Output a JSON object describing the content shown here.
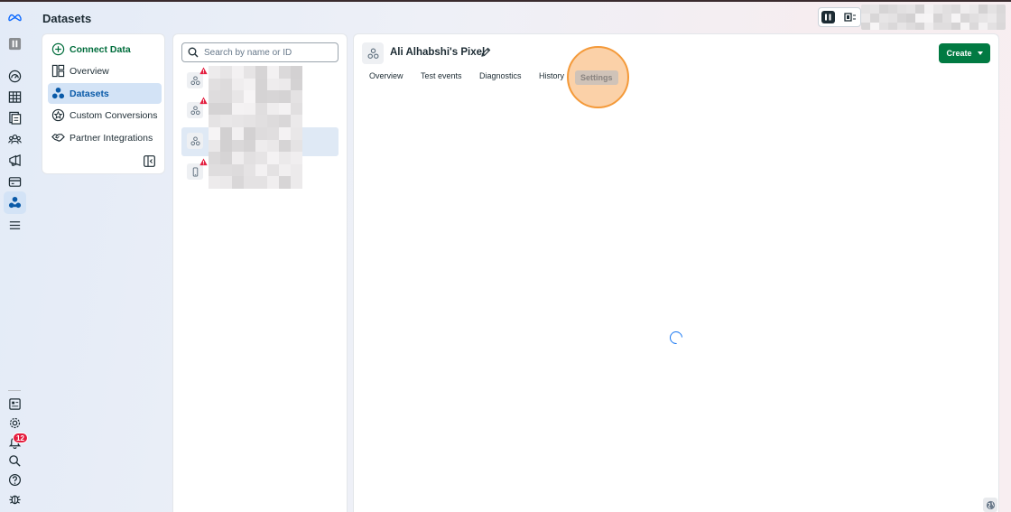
{
  "header": {
    "title": "Datasets"
  },
  "badges": {
    "notifications": "12"
  },
  "nav": {
    "connect": "Connect Data",
    "items": [
      "Overview",
      "Datasets",
      "Custom Conversions",
      "Partner Integrations"
    ]
  },
  "search": {
    "placeholder": "Search by name or ID"
  },
  "detail": {
    "title": "Ali Alhabshi's Pixel",
    "tabs": [
      "Overview",
      "Test events",
      "Diagnostics",
      "History",
      "Settings"
    ],
    "active_tab": "Settings",
    "create_label": "Create",
    "loading": true
  },
  "colors": {
    "accent_green": "#017a42",
    "selection_blue": "#d3e3f6",
    "highlight_orange": "#f49a3a",
    "warning_red": "#e41e3f"
  },
  "icons": [
    "meta-logo",
    "account-icon",
    "gauge-icon",
    "table-icon",
    "pages-icon",
    "audience-icon",
    "megaphone-icon",
    "billing-icon",
    "events-manager-icon",
    "menu-icon",
    "report-icon",
    "gear-icon",
    "bell-icon",
    "search-icon",
    "help-icon",
    "bug-icon"
  ]
}
